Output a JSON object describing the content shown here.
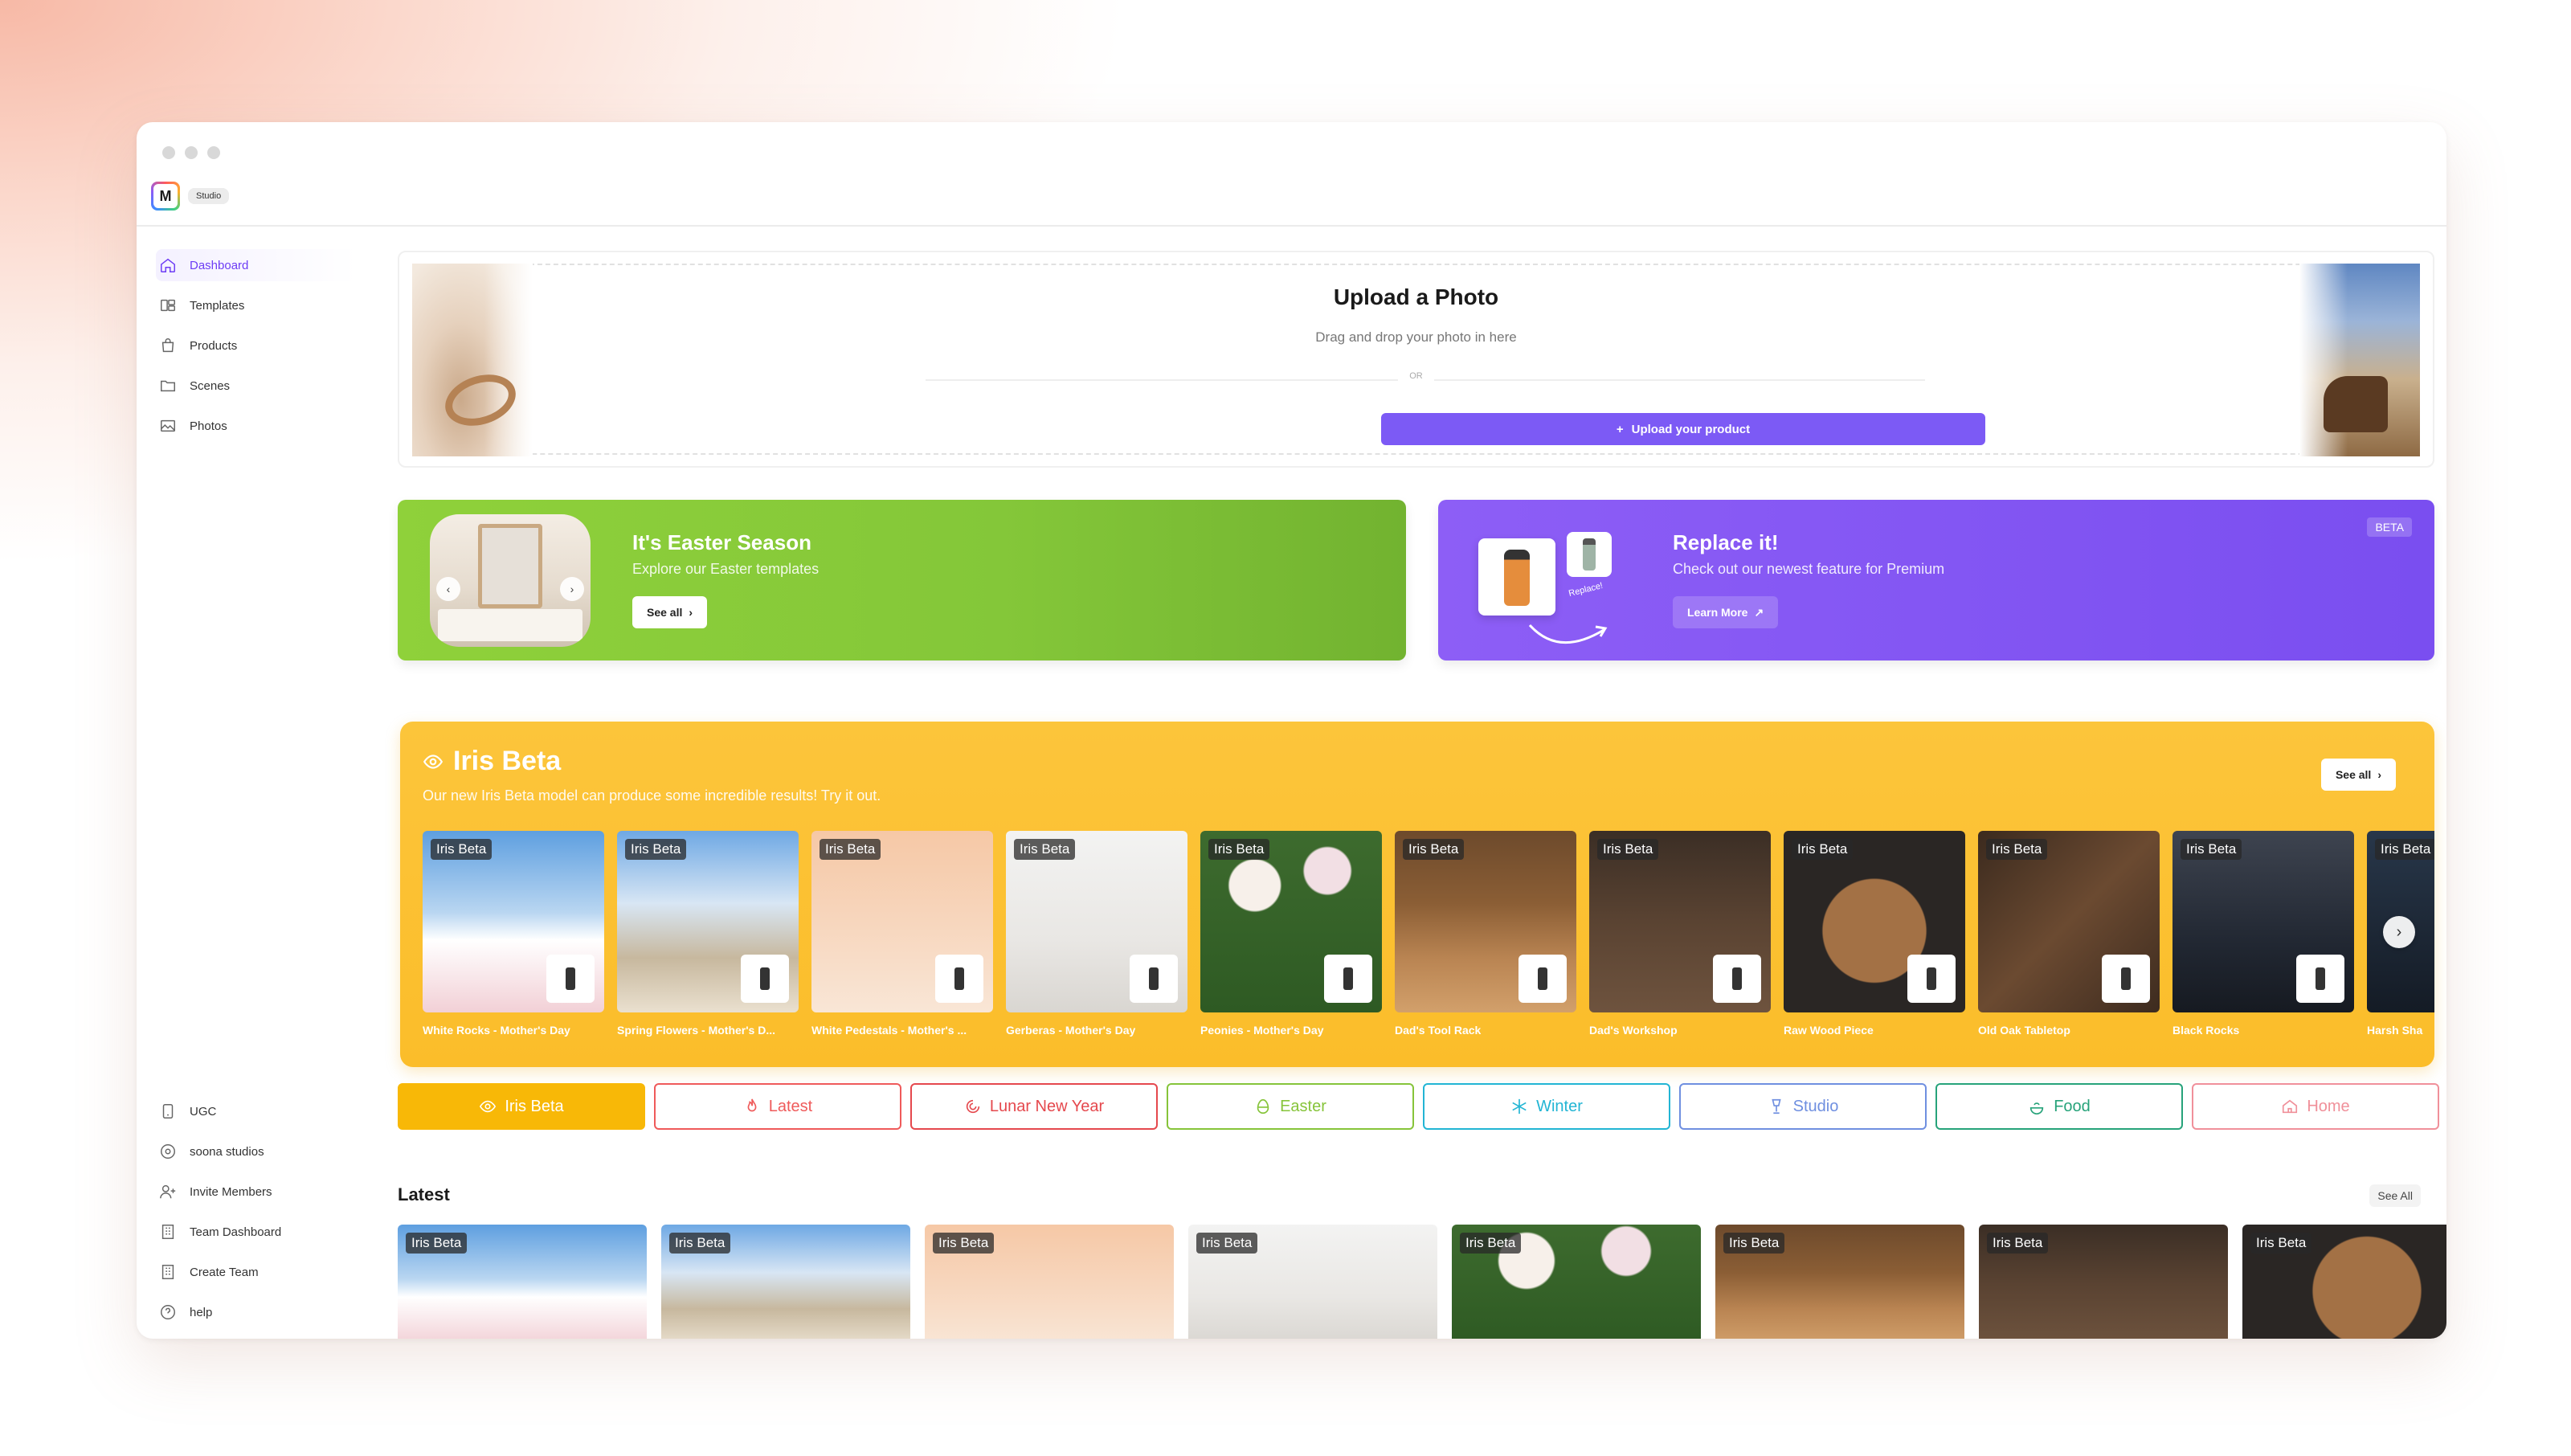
{
  "app": {
    "logo_letter": "M",
    "badge": "Studio"
  },
  "sidebar": {
    "top_items": [
      {
        "label": "Dashboard",
        "icon": "home-icon",
        "active": true
      },
      {
        "label": "Templates",
        "icon": "templates-icon"
      },
      {
        "label": "Products",
        "icon": "bag-icon"
      },
      {
        "label": "Scenes",
        "icon": "folder-icon"
      },
      {
        "label": "Photos",
        "icon": "image-icon"
      }
    ],
    "bottom_items": [
      {
        "label": "UGC",
        "icon": "phone-icon"
      },
      {
        "label": "soona studios",
        "icon": "camera-icon"
      },
      {
        "label": "Invite Members",
        "icon": "user-plus-icon"
      },
      {
        "label": "Team Dashboard",
        "icon": "building-icon"
      },
      {
        "label": "Create Team",
        "icon": "building-icon"
      },
      {
        "label": "help",
        "icon": "help-icon"
      }
    ]
  },
  "upload": {
    "title": "Upload a Photo",
    "subtitle": "Drag and drop your photo in here",
    "or": "OR",
    "button": "Upload your product"
  },
  "easter_banner": {
    "title": "It's Easter Season",
    "subtitle": "Explore our Easter templates",
    "button": "See all",
    "color": "#84c739"
  },
  "replace_banner": {
    "title": "Replace it!",
    "subtitle": "Check out our newest feature for Premium",
    "button": "Learn More",
    "badge": "BETA",
    "art_label": "Replace!",
    "color": "#7f52f3"
  },
  "iris": {
    "title": "Iris Beta",
    "subtitle": "Our new Iris Beta model can produce some incredible results! Try it out.",
    "see_all": "See all",
    "tag": "Iris Beta",
    "thumbs": [
      {
        "label": "White Rocks - Mother's Day"
      },
      {
        "label": "Spring Flowers - Mother's D..."
      },
      {
        "label": "White Pedestals - Mother's ..."
      },
      {
        "label": "Gerberas - Mother's Day"
      },
      {
        "label": "Peonies - Mother's Day"
      },
      {
        "label": "Dad's Tool Rack"
      },
      {
        "label": "Dad's Workshop"
      },
      {
        "label": "Raw Wood Piece"
      },
      {
        "label": "Old Oak Tabletop"
      },
      {
        "label": "Black Rocks"
      },
      {
        "label": "Harsh Sha"
      }
    ]
  },
  "filters": [
    {
      "label": "Iris Beta",
      "icon": "iris-icon",
      "active": true,
      "color": "#f8b807"
    },
    {
      "label": "Latest",
      "icon": "flame-icon",
      "color": "#ef5a5a"
    },
    {
      "label": "Lunar New Year",
      "icon": "lunar-icon",
      "color": "#e5484d"
    },
    {
      "label": "Easter",
      "icon": "egg-icon",
      "color": "#86c43a"
    },
    {
      "label": "Winter",
      "icon": "snowflake-icon",
      "color": "#22b5d4"
    },
    {
      "label": "Studio",
      "icon": "lamp-icon",
      "color": "#6f8fe0"
    },
    {
      "label": "Food",
      "icon": "food-icon",
      "color": "#27a37a"
    },
    {
      "label": "Home",
      "icon": "house-icon",
      "color": "#f0909a"
    }
  ],
  "latest": {
    "title": "Latest",
    "see_all": "See All",
    "tag": "Iris Beta",
    "count": 8
  }
}
